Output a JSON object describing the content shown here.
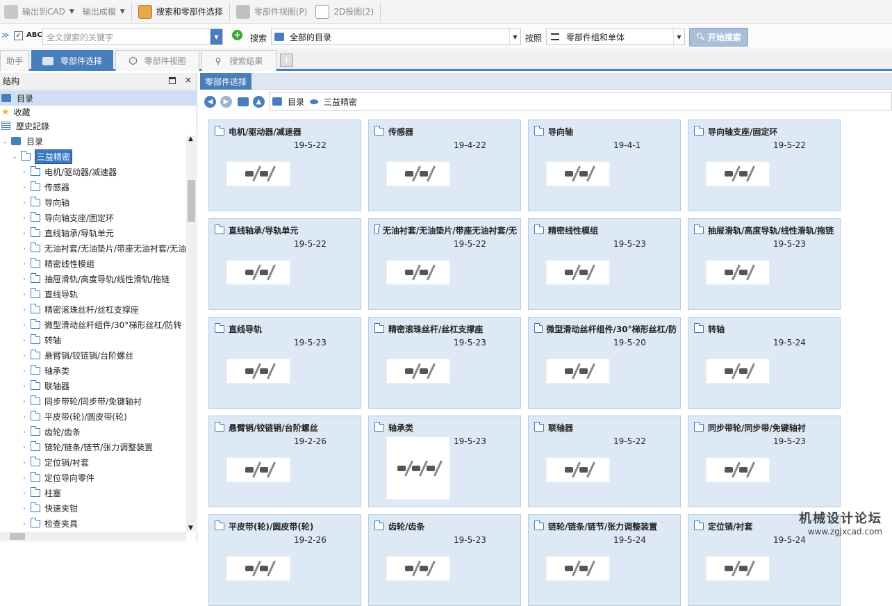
{
  "toolbar1": {
    "export_cad": "输出到CAD",
    "export_doc": "输出成檔",
    "search_select": "搜索和零部件选择",
    "part_view": "零部件视图(P)",
    "view_2d": "2D投图(2)"
  },
  "toolbar2": {
    "abc": "ABC",
    "fulltext_placeholder": "全文搜索的关键字",
    "search_label": "搜索",
    "catalog_value": "全部的目录",
    "by_label": "按照",
    "group_value": "零部件组和单体",
    "start_search": "开始搜索"
  },
  "tabs": [
    "助手",
    "零部件选择",
    "零部件视图",
    "搜索结果",
    "+"
  ],
  "left": {
    "header": "结构",
    "top_items": [
      "目录",
      "收藏",
      "歷史記錄"
    ],
    "catalog": "目录",
    "root": "三益精密",
    "items": [
      "电机/驱动器/减速器",
      "传感器",
      "导向轴",
      "导向轴支座/固定环",
      "直线轴承/导轨单元",
      "无油衬套/无油垫片/带座无油衬套/无油",
      "精密线性模组",
      "抽屉滑轨/高度导轨/线性滑轨/拖链",
      "直线导轨",
      "精密滚珠丝杆/丝杠支撑座",
      "微型滑动丝杆组件/30°梯形丝杠/防转",
      "转轴",
      "悬臂销/铰链销/台阶螺丝",
      "轴承类",
      "联轴器",
      "同步带轮/同步带/免键轴衬",
      "平皮带(轮)/圆皮带(轮)",
      "齿轮/齿条",
      "链轮/链条/链节/张力调整装置",
      "定位销/衬套",
      "定位导向零件",
      "柱塞",
      "快速夹钳",
      "检查夹具"
    ]
  },
  "right": {
    "tab": "零部件选择",
    "breadcrumb": [
      "目录",
      "三益精密"
    ],
    "cards": [
      {
        "title": "电机/驱动器/减速器",
        "date": "19-5-22"
      },
      {
        "title": "传感器",
        "date": "19-4-22"
      },
      {
        "title": "导向轴",
        "date": "19-4-1"
      },
      {
        "title": "导向轴支座/固定环",
        "date": "19-5-22"
      },
      {
        "title": "直线轴承/导轨单元",
        "date": "19-5-22"
      },
      {
        "title": "无油衬套/无油垫片/带座无油衬套/无",
        "date": "19-5-22"
      },
      {
        "title": "精密线性模组",
        "date": "19-5-23"
      },
      {
        "title": "抽屉滑轨/高度导轨/线性滑轨/拖链",
        "date": "19-5-23"
      },
      {
        "title": "直线导轨",
        "date": "19-5-23"
      },
      {
        "title": "精密滚珠丝杆/丝杠支撑座",
        "date": "19-5-23"
      },
      {
        "title": "微型滑动丝杆组件/30°梯形丝杠/防",
        "date": "19-5-20"
      },
      {
        "title": "转轴",
        "date": "19-5-24"
      },
      {
        "title": "悬臂销/铰链销/台阶螺丝",
        "date": "19-2-26"
      },
      {
        "title": "轴承类",
        "date": "19-5-23"
      },
      {
        "title": "联轴器",
        "date": "19-5-22"
      },
      {
        "title": "同步带轮/同步带/免键轴衬",
        "date": "19-5-23"
      },
      {
        "title": "平皮带(轮)/圆皮带(轮)",
        "date": "19-2-26"
      },
      {
        "title": "齿轮/齿条",
        "date": "19-5-23"
      },
      {
        "title": "链轮/链条/链节/张力调整装置",
        "date": "19-5-24"
      },
      {
        "title": "定位销/衬套",
        "date": "19-5-24"
      }
    ]
  },
  "watermark": {
    "title": "机械设计论坛",
    "url": "www.zgjxcad.com"
  },
  "colors": {
    "accent": "#4a7ebb",
    "card_bg": "#dde9f5",
    "selected": "#3a78c2"
  }
}
